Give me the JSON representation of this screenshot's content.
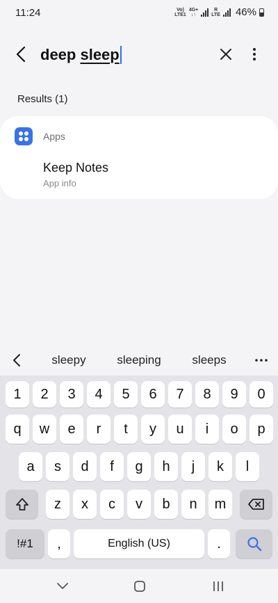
{
  "status": {
    "time": "11:24",
    "net1_top": "Vo)",
    "net1_bottom": "LTE1",
    "net2_top": "4G+",
    "net2_bottom": "↓↑",
    "net3_top": "R",
    "net3_bottom": "LTE",
    "battery": "46%"
  },
  "search": {
    "query_plain": "deep ",
    "query_highlight": "sleep"
  },
  "results": {
    "label": "Results (1)",
    "category": "Apps",
    "items": [
      {
        "title": "Keep Notes",
        "subtitle": "App info"
      }
    ]
  },
  "suggestions": [
    "sleepy",
    "sleeping",
    "sleeps"
  ],
  "keyboard": {
    "row_numbers": [
      "1",
      "2",
      "3",
      "4",
      "5",
      "6",
      "7",
      "8",
      "9",
      "0"
    ],
    "row1": [
      "q",
      "w",
      "e",
      "r",
      "t",
      "y",
      "u",
      "i",
      "o",
      "p"
    ],
    "row2": [
      "a",
      "s",
      "d",
      "f",
      "g",
      "h",
      "j",
      "k",
      "l"
    ],
    "row3": [
      "z",
      "x",
      "c",
      "v",
      "b",
      "n",
      "m"
    ],
    "symbols": "!#1",
    "comma": ",",
    "space": "English (US)",
    "period": "."
  },
  "colors": {
    "accent": "#3a72e8",
    "caret": "#2b6cff"
  }
}
